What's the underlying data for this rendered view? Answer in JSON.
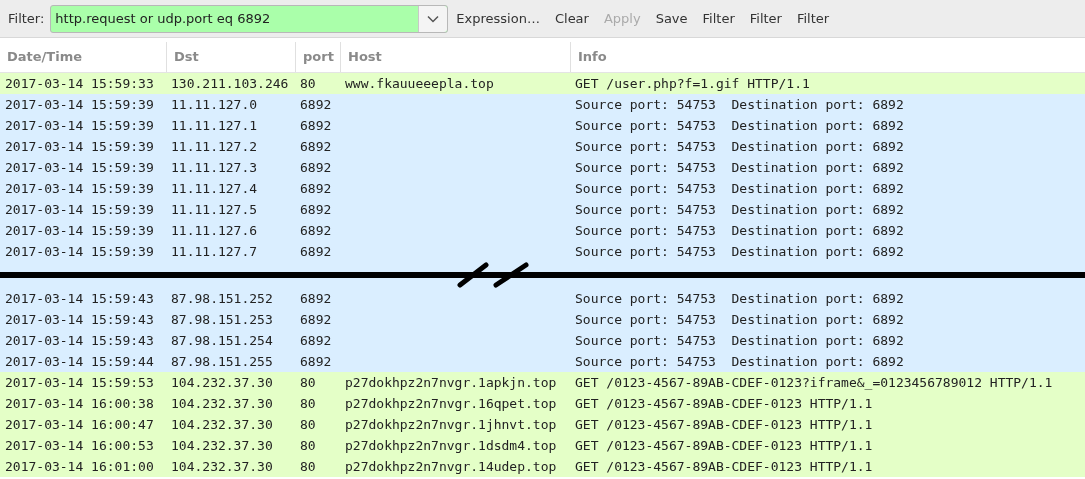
{
  "toolbar": {
    "filter_label": "Filter:",
    "filter_value": "http.request or udp.port eq 6892",
    "buttons": [
      {
        "label": "Expression…",
        "disabled": false
      },
      {
        "label": "Clear",
        "disabled": false
      },
      {
        "label": "Apply",
        "disabled": true
      },
      {
        "label": "Save",
        "disabled": false
      },
      {
        "label": "Filter",
        "disabled": false
      },
      {
        "label": "Filter",
        "disabled": false
      },
      {
        "label": "Filter",
        "disabled": false
      }
    ]
  },
  "table": {
    "columns": [
      "Date/Time",
      "Dst",
      "port",
      "Host",
      "Info"
    ],
    "rows": [
      {
        "kind": "packet",
        "color": "#e4ffc7",
        "cells": [
          "2017-03-14 15:59:33",
          "130.211.103.246",
          "80",
          "www.fkauueeepla.top",
          "GET /user.php?f=1.gif HTTP/1.1"
        ]
      },
      {
        "kind": "packet",
        "color": "#daeeff",
        "cells": [
          "2017-03-14 15:59:39",
          "11.11.127.0",
          "6892",
          "",
          "Source port: 54753  Destination port: 6892"
        ]
      },
      {
        "kind": "packet",
        "color": "#daeeff",
        "cells": [
          "2017-03-14 15:59:39",
          "11.11.127.1",
          "6892",
          "",
          "Source port: 54753  Destination port: 6892"
        ]
      },
      {
        "kind": "packet",
        "color": "#daeeff",
        "cells": [
          "2017-03-14 15:59:39",
          "11.11.127.2",
          "6892",
          "",
          "Source port: 54753  Destination port: 6892"
        ]
      },
      {
        "kind": "packet",
        "color": "#daeeff",
        "cells": [
          "2017-03-14 15:59:39",
          "11.11.127.3",
          "6892",
          "",
          "Source port: 54753  Destination port: 6892"
        ]
      },
      {
        "kind": "packet",
        "color": "#daeeff",
        "cells": [
          "2017-03-14 15:59:39",
          "11.11.127.4",
          "6892",
          "",
          "Source port: 54753  Destination port: 6892"
        ]
      },
      {
        "kind": "packet",
        "color": "#daeeff",
        "cells": [
          "2017-03-14 15:59:39",
          "11.11.127.5",
          "6892",
          "",
          "Source port: 54753  Destination port: 6892"
        ]
      },
      {
        "kind": "packet",
        "color": "#daeeff",
        "cells": [
          "2017-03-14 15:59:39",
          "11.11.127.6",
          "6892",
          "",
          "Source port: 54753  Destination port: 6892"
        ]
      },
      {
        "kind": "packet",
        "color": "#daeeff",
        "cells": [
          "2017-03-14 15:59:39",
          "11.11.127.7",
          "6892",
          "",
          "Source port: 54753  Destination port: 6892"
        ]
      },
      {
        "kind": "break",
        "color": "#daeeff"
      },
      {
        "kind": "packet",
        "color": "#daeeff",
        "cells": [
          "2017-03-14 15:59:43",
          "87.98.151.252",
          "6892",
          "",
          "Source port: 54753  Destination port: 6892"
        ]
      },
      {
        "kind": "packet",
        "color": "#daeeff",
        "cells": [
          "2017-03-14 15:59:43",
          "87.98.151.253",
          "6892",
          "",
          "Source port: 54753  Destination port: 6892"
        ]
      },
      {
        "kind": "packet",
        "color": "#daeeff",
        "cells": [
          "2017-03-14 15:59:43",
          "87.98.151.254",
          "6892",
          "",
          "Source port: 54753  Destination port: 6892"
        ]
      },
      {
        "kind": "packet",
        "color": "#daeeff",
        "cells": [
          "2017-03-14 15:59:44",
          "87.98.151.255",
          "6892",
          "",
          "Source port: 54753  Destination port: 6892"
        ]
      },
      {
        "kind": "packet",
        "color": "#e4ffc7",
        "cells": [
          "2017-03-14 15:59:53",
          "104.232.37.30",
          "80",
          "p27dokhpz2n7nvgr.1apkjn.top",
          "GET /0123-4567-89AB-CDEF-0123?iframe&_=0123456789012 HTTP/1.1"
        ]
      },
      {
        "kind": "packet",
        "color": "#e4ffc7",
        "cells": [
          "2017-03-14 16:00:38",
          "104.232.37.30",
          "80",
          "p27dokhpz2n7nvgr.16qpet.top",
          "GET /0123-4567-89AB-CDEF-0123 HTTP/1.1"
        ]
      },
      {
        "kind": "packet",
        "color": "#e4ffc7",
        "cells": [
          "2017-03-14 16:00:47",
          "104.232.37.30",
          "80",
          "p27dokhpz2n7nvgr.1jhnvt.top",
          "GET /0123-4567-89AB-CDEF-0123 HTTP/1.1"
        ]
      },
      {
        "kind": "packet",
        "color": "#e4ffc7",
        "cells": [
          "2017-03-14 16:00:53",
          "104.232.37.30",
          "80",
          "p27dokhpz2n7nvgr.1dsdm4.top",
          "GET /0123-4567-89AB-CDEF-0123 HTTP/1.1"
        ]
      },
      {
        "kind": "packet",
        "color": "#e4ffc7",
        "cells": [
          "2017-03-14 16:01:00",
          "104.232.37.30",
          "80",
          "p27dokhpz2n7nvgr.14udep.top",
          "GET /0123-4567-89AB-CDEF-0123 HTTP/1.1"
        ]
      }
    ]
  }
}
